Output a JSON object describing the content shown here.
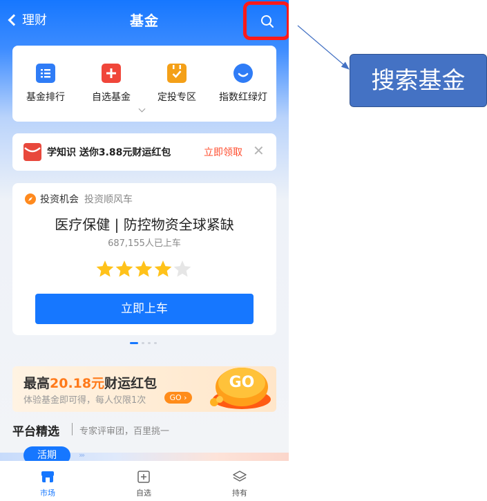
{
  "header": {
    "back_label": "理财",
    "title": "基金"
  },
  "menu": {
    "items": [
      {
        "label": "基金排行",
        "icon": "list-icon",
        "color": "#2f7cf6"
      },
      {
        "label": "自选基金",
        "icon": "plus-icon",
        "color": "#f0463a"
      },
      {
        "label": "定投专区",
        "icon": "calendar-check-icon",
        "color": "#f4a018"
      },
      {
        "label": "指数红绿灯",
        "icon": "chat-smile-icon",
        "color": "#2f7cf6"
      }
    ]
  },
  "promo": {
    "text": "学知识 送你3.88元财运红包",
    "action": "立即领取"
  },
  "investment": {
    "tag": "投资机会",
    "tag_sub": "投资顺风车",
    "title": "医疗保健 | 防控物资全球紧缺",
    "count": "687,155人已上车",
    "rating": 4,
    "rating_max": 5,
    "button": "立即上车"
  },
  "carousel": {
    "count": 4,
    "active": 0
  },
  "banner": {
    "title_prefix": "最高",
    "title_amount": "20.18元",
    "title_suffix": "财运红包",
    "subtitle": "体验基金即可得，每人仅限1次",
    "pill": "GO ›",
    "graphic_text": "GO"
  },
  "section": {
    "title": "平台精选",
    "subtitle": "专家评审团，百里挑一",
    "active_tab": "活期"
  },
  "bottom_nav": [
    {
      "label": "市场",
      "active": true,
      "icon": "store-icon"
    },
    {
      "label": "自选",
      "active": false,
      "icon": "add-square-icon"
    },
    {
      "label": "持有",
      "active": false,
      "icon": "layers-icon"
    }
  ],
  "annotation": {
    "callout_text": "搜索基金"
  },
  "colors": {
    "primary": "#1677ff",
    "highlight_border": "#ff1a1a",
    "callout_bg": "#4472c4",
    "promo_red": "#ff4d2e",
    "star": "#ffc21a"
  }
}
